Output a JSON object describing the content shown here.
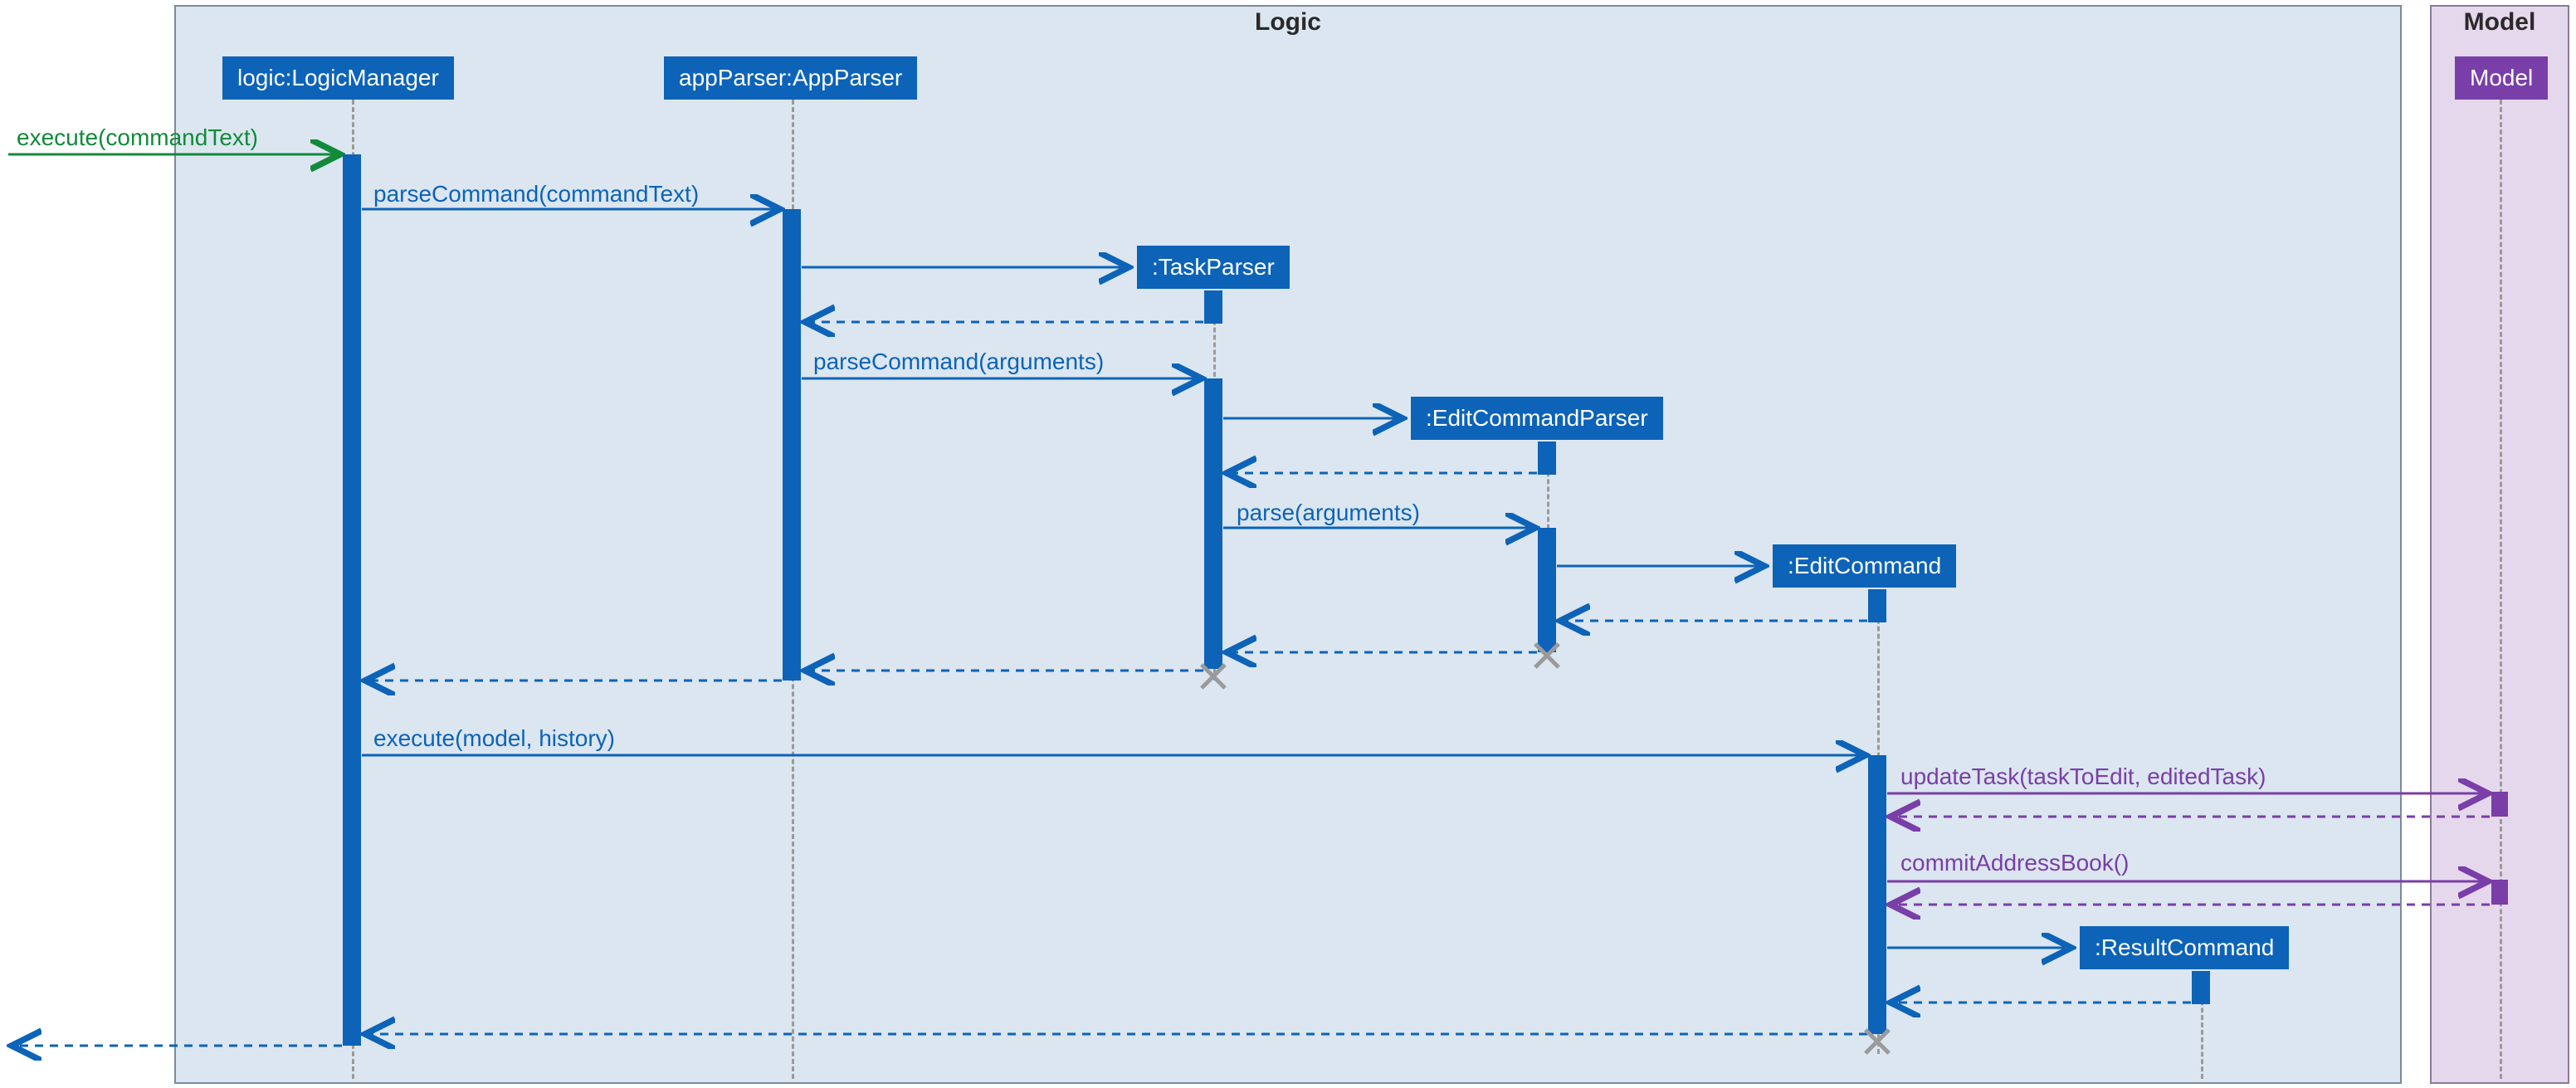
{
  "regions": {
    "logic": {
      "title": "Logic"
    },
    "model": {
      "title": "Model"
    }
  },
  "participants": {
    "logicManager": "logic:LogicManager",
    "appParser": "appParser:AppParser",
    "taskParser": ":TaskParser",
    "editCommandParser": ":EditCommandParser",
    "editCommand": ":EditCommand",
    "modelObj": "Model",
    "resultCommand": ":ResultCommand"
  },
  "messages": {
    "executeCommandText": "execute(commandText)",
    "parseCommandText": "parseCommand(commandText)",
    "parseCommandArgs": "parseCommand(arguments)",
    "parseArgs": "parse(arguments)",
    "executeModelHistory": "execute(model, history)",
    "updateTask": "updateTask(taskToEdit, editedTask)",
    "commitAddressBook": "commitAddressBook()"
  },
  "chart_data": {
    "type": "sequence-diagram",
    "regions": [
      {
        "name": "Logic",
        "participants": [
          "logic:LogicManager",
          "appParser:AppParser",
          ":TaskParser",
          ":EditCommandParser",
          ":EditCommand",
          ":ResultCommand"
        ]
      },
      {
        "name": "Model",
        "participants": [
          "Model"
        ]
      }
    ],
    "messages": [
      {
        "from": "actor",
        "to": "logic:LogicManager",
        "label": "execute(commandText)",
        "kind": "sync",
        "color": "green"
      },
      {
        "from": "logic:LogicManager",
        "to": "appParser:AppParser",
        "label": "parseCommand(commandText)",
        "kind": "sync"
      },
      {
        "from": "appParser:AppParser",
        "to": ":TaskParser",
        "label": "",
        "kind": "create"
      },
      {
        "from": ":TaskParser",
        "to": "appParser:AppParser",
        "label": "",
        "kind": "return"
      },
      {
        "from": "appParser:AppParser",
        "to": ":TaskParser",
        "label": "parseCommand(arguments)",
        "kind": "sync"
      },
      {
        "from": ":TaskParser",
        "to": ":EditCommandParser",
        "label": "",
        "kind": "create"
      },
      {
        "from": ":EditCommandParser",
        "to": ":TaskParser",
        "label": "",
        "kind": "return"
      },
      {
        "from": ":TaskParser",
        "to": ":EditCommandParser",
        "label": "parse(arguments)",
        "kind": "sync"
      },
      {
        "from": ":EditCommandParser",
        "to": ":EditCommand",
        "label": "",
        "kind": "create"
      },
      {
        "from": ":EditCommand",
        "to": ":EditCommandParser",
        "label": "",
        "kind": "return"
      },
      {
        "from": ":EditCommandParser",
        "to": ":TaskParser",
        "label": "",
        "kind": "return",
        "destroys": ":EditCommandParser"
      },
      {
        "from": ":TaskParser",
        "to": "appParser:AppParser",
        "label": "",
        "kind": "return",
        "destroys": ":TaskParser"
      },
      {
        "from": "appParser:AppParser",
        "to": "logic:LogicManager",
        "label": "",
        "kind": "return"
      },
      {
        "from": "logic:LogicManager",
        "to": ":EditCommand",
        "label": "execute(model, history)",
        "kind": "sync"
      },
      {
        "from": ":EditCommand",
        "to": "Model",
        "label": "updateTask(taskToEdit, editedTask)",
        "kind": "sync",
        "color": "purple"
      },
      {
        "from": "Model",
        "to": ":EditCommand",
        "label": "",
        "kind": "return",
        "color": "purple"
      },
      {
        "from": ":EditCommand",
        "to": "Model",
        "label": "commitAddressBook()",
        "kind": "sync",
        "color": "purple"
      },
      {
        "from": "Model",
        "to": ":EditCommand",
        "label": "",
        "kind": "return",
        "color": "purple"
      },
      {
        "from": ":EditCommand",
        "to": ":ResultCommand",
        "label": "",
        "kind": "create"
      },
      {
        "from": ":ResultCommand",
        "to": ":EditCommand",
        "label": "",
        "kind": "return"
      },
      {
        "from": ":EditCommand",
        "to": "logic:LogicManager",
        "label": "",
        "kind": "return",
        "destroys": ":EditCommand"
      },
      {
        "from": "logic:LogicManager",
        "to": "actor",
        "label": "",
        "kind": "return"
      }
    ]
  }
}
